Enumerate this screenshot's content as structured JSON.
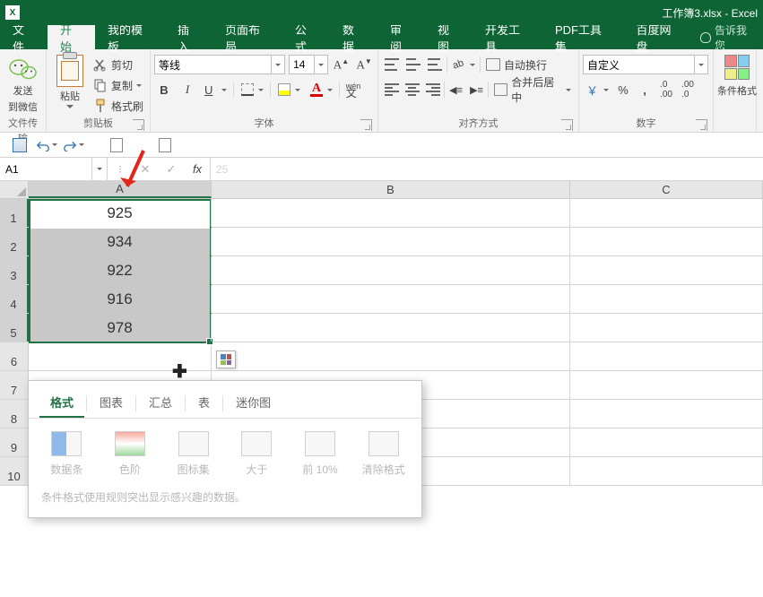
{
  "titlebar": {
    "title": "工作簿3.xlsx - Excel"
  },
  "menubar": {
    "tabs": [
      "文件",
      "开始",
      "我的模板",
      "插入",
      "页面布局",
      "公式",
      "数据",
      "审阅",
      "视图",
      "开发工具",
      "PDF工具集",
      "百度网盘"
    ],
    "active_index": 1,
    "tell_me": "告诉我您"
  },
  "ribbon": {
    "wechat": {
      "line1": "发送",
      "line2": "到微信",
      "group_label": "文件传输"
    },
    "clipboard": {
      "paste": "粘贴",
      "cut": "剪切",
      "copy": "复制",
      "format_painter": "格式刷",
      "group_label": "剪贴板"
    },
    "font": {
      "font_name": "等线",
      "font_size": "14",
      "bold": "B",
      "italic": "I",
      "underline": "U",
      "inc_font": "A",
      "dec_font": "A",
      "group_label": "字体"
    },
    "alignment": {
      "wrap_text": "自动换行",
      "merge_center": "合并后居中",
      "group_label": "对齐方式"
    },
    "number": {
      "format": "自定义",
      "group_label": "数字"
    },
    "cond": {
      "label": "条件格式"
    }
  },
  "formula_bar": {
    "name_box": "A1",
    "fx": "fx",
    "value": "25"
  },
  "grid": {
    "columns": [
      "A",
      "B",
      "C"
    ],
    "row_headers": [
      1,
      2,
      3,
      4,
      5,
      6,
      7,
      8,
      9,
      10
    ],
    "data": {
      "A1": "925",
      "A2": "934",
      "A3": "922",
      "A4": "916",
      "A5": "978"
    },
    "selection": {
      "start": "A1",
      "end": "A5",
      "active": "A1"
    }
  },
  "quick_analysis": {
    "tabs": [
      "格式",
      "图表",
      "汇总",
      "表",
      "迷你图"
    ],
    "active_tab_index": 0,
    "items": [
      "数据条",
      "色阶",
      "图标集",
      "大于",
      "前 10%",
      "清除格式"
    ],
    "footer": "条件格式使用规则突出显示感兴趣的数据。"
  }
}
